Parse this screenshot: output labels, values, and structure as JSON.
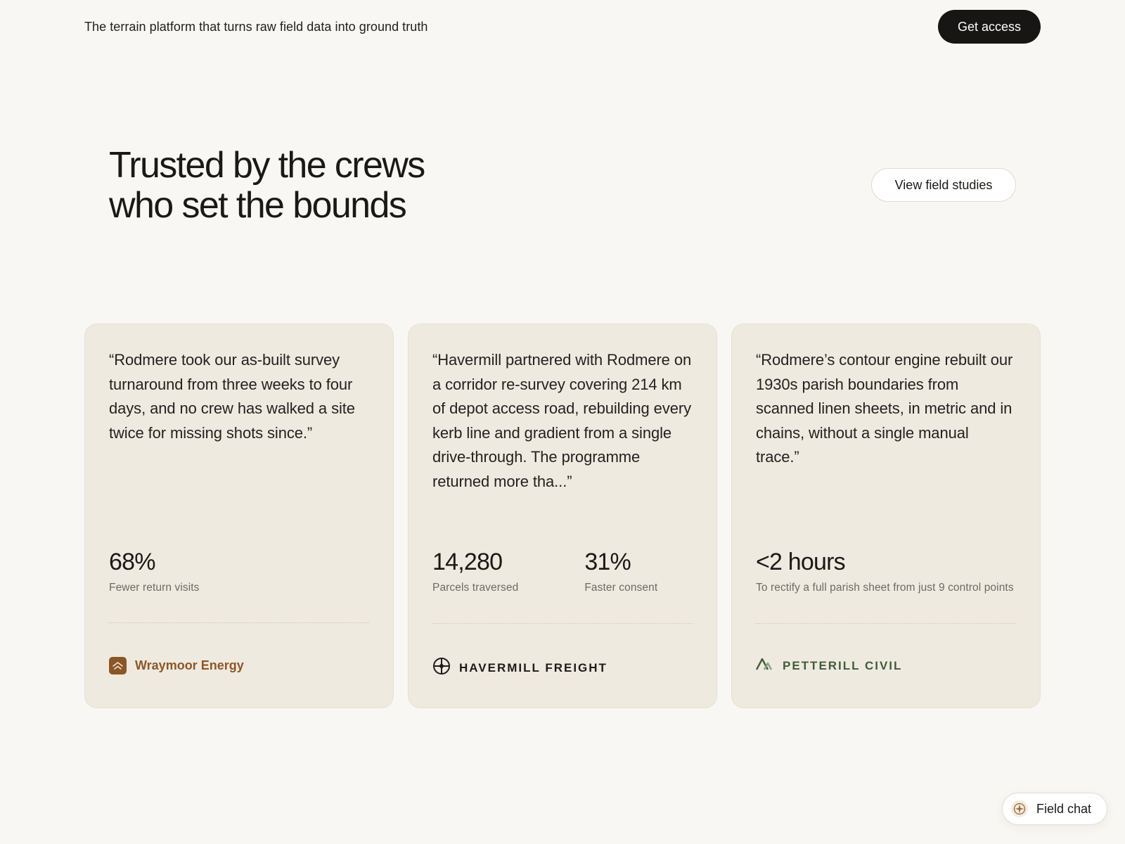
{
  "header": {
    "tagline": "The terrain platform that turns raw field data into ground truth",
    "cta_label": "Get access"
  },
  "hero": {
    "headline_line1": "Trusted by the crews",
    "headline_line2": "who set the bounds",
    "secondary_cta_label": "View field studies"
  },
  "testimonials": [
    {
      "quote": "“Rodmere took our as-built survey turnaround from three weeks to four days, and no crew has walked a site twice for missing shots since.”",
      "stats": [
        {
          "value": "68%",
          "label": "Fewer return visits"
        }
      ],
      "company": "Wraymoor Energy",
      "logo_icon": "chevron-up-logo-icon",
      "brand_color": "#8c5729"
    },
    {
      "quote": "“Havermill partnered with Rodmere on a corridor re-survey covering 214 km of depot access road, rebuilding every kerb line and gradient from a single drive-through. The programme returned more tha...”",
      "stats": [
        {
          "value": "14,280",
          "label": "Parcels traversed"
        },
        {
          "value": "31%",
          "label": "Faster consent"
        }
      ],
      "company": "HAVERMILL FREIGHT",
      "logo_icon": "crosshair-logo-icon",
      "brand_color": "#1d1c19"
    },
    {
      "quote": "“Rodmere’s contour engine rebuilt our 1930s parish boundaries from scanned linen sheets, in metric and in chains, without a single manual trace.”",
      "stats": [
        {
          "value": "<2 hours",
          "label": "To rectify a full parish sheet from just 9 control points"
        }
      ],
      "company": "PETTERILL CIVIL",
      "logo_icon": "mountain-logo-icon",
      "brand_color": "#3f5d39"
    }
  ],
  "chat": {
    "label": "Field chat",
    "icon": "compass-icon"
  }
}
